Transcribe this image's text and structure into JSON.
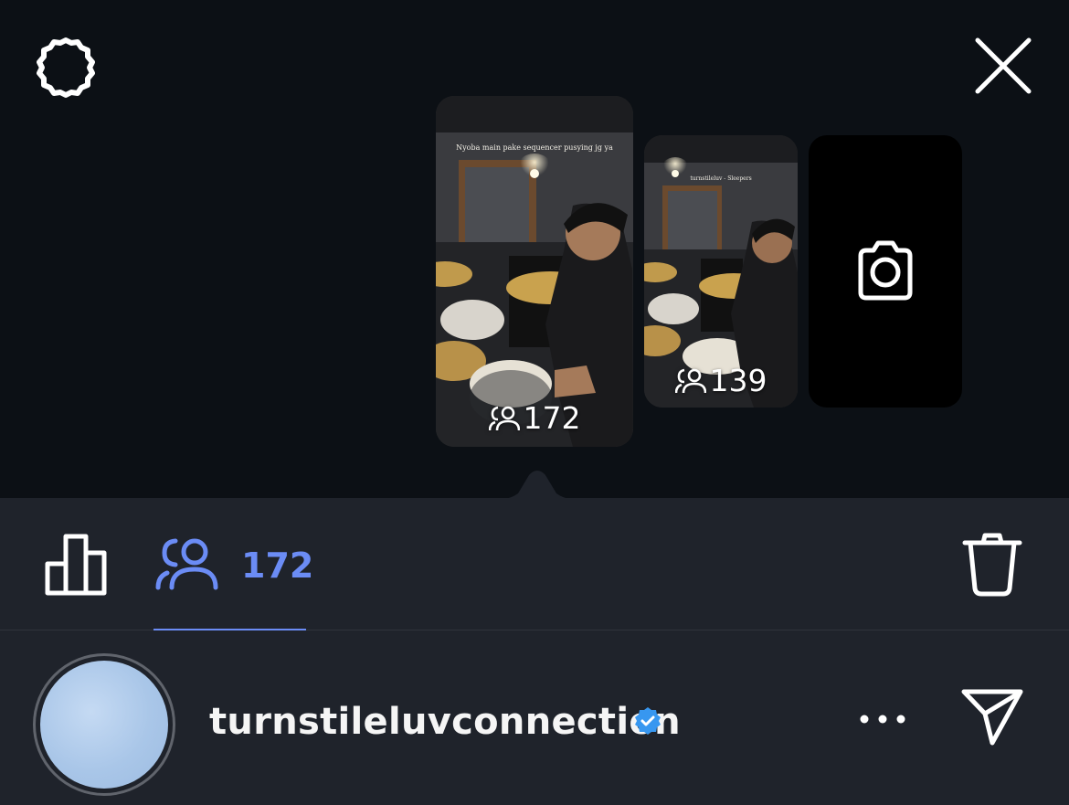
{
  "header": {
    "settings_icon": "gear-icon",
    "close_icon": "close-icon"
  },
  "stories": [
    {
      "caption": "Nyoba main pake sequencer pusying jg ya",
      "viewer_icon": "viewers-icon",
      "viewers": "172"
    },
    {
      "caption": "turnstileluv - Sleepers",
      "viewer_icon": "viewers-icon",
      "viewers": "139"
    },
    {
      "action": "add-story",
      "icon": "camera-icon"
    }
  ],
  "toolbar": {
    "insights_icon": "bar-chart-icon",
    "viewers_icon": "viewers-icon",
    "viewers_count": "172",
    "delete_icon": "trash-icon"
  },
  "user": {
    "username": "turnstileluvconnection",
    "verified": true,
    "more_icon": "more-icon",
    "send_icon": "send-icon"
  },
  "colors": {
    "background": "#0c1015",
    "panel": "#1f232b",
    "accent": "#6b8cf5",
    "verified": "#3797f0"
  }
}
